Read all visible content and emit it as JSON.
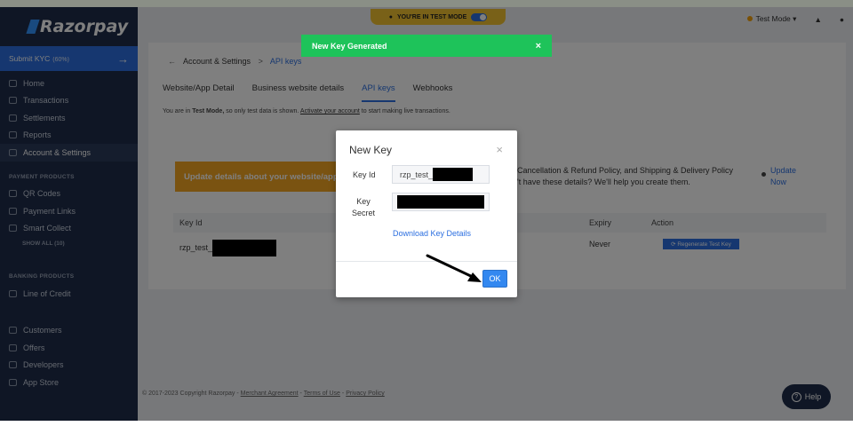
{
  "app": {
    "logo": "Razorpay"
  },
  "sidebar": {
    "kyc_label": "Submit KYC",
    "kyc_progress": "(60%)",
    "kyc_arrow": "→",
    "items": [
      {
        "label": "Home",
        "icon": "home-icon"
      },
      {
        "label": "Transactions",
        "icon": "transactions-icon"
      },
      {
        "label": "Settlements",
        "icon": "settlements-icon"
      },
      {
        "label": "Reports",
        "icon": "reports-icon"
      },
      {
        "label": "Account & Settings",
        "icon": "gear-icon",
        "active": true
      }
    ],
    "payment_heading": "PAYMENT PRODUCTS",
    "payment_items": [
      {
        "label": "QR Codes",
        "icon": "qr-icon"
      },
      {
        "label": "Payment Links",
        "icon": "link-icon"
      },
      {
        "label": "Smart Collect",
        "icon": "bank-icon"
      }
    ],
    "show_all": "SHOW ALL (10)",
    "banking_heading": "BANKING PRODUCTS",
    "banking_items": [
      {
        "label": "Line of Credit",
        "icon": "credit-icon"
      }
    ],
    "bottom_items": [
      {
        "label": "Customers",
        "icon": "customers-icon"
      },
      {
        "label": "Offers",
        "icon": "offers-icon"
      },
      {
        "label": "Developers",
        "icon": "code-icon"
      },
      {
        "label": "App Store",
        "icon": "apps-icon"
      }
    ]
  },
  "header": {
    "mode_pill": "YOU'RE IN TEST MODE",
    "mode_select": "Test Mode",
    "mode_caret": "▾"
  },
  "page": {
    "back": "←",
    "breadcrumb_parent": "Account & Settings",
    "breadcrumb_sep": ">",
    "breadcrumb_current": "API keys",
    "tabs": [
      "Website/App Detail",
      "Business website details",
      "API keys",
      "Webhooks"
    ],
    "notice_prefix": "You are in",
    "notice_mode": "Test Mode,",
    "notice_mid": "so only test data is shown.",
    "notice_link": "Activate your account",
    "notice_suffix": "to start making live transactions.",
    "banner_left": "Update details about your website/app",
    "banner_right": "Cancellation & Refund Policy, and Shipping & Delivery Policy\n't have these details? We'll help you create them.",
    "banner_link": "Update\nNow",
    "table": {
      "headers": [
        "Key Id",
        "Expiry",
        "Action"
      ],
      "row": {
        "key_id": "rzp_test_",
        "expiry": "Never",
        "action": "⟳ Regenerate Test Key"
      }
    },
    "footer": {
      "copyright": "© 2017-2023 Copyright Razorpay",
      "link1": "Merchant Agreement",
      "link2": "Terms of Use",
      "link3": "Privacy Policy",
      "sep": " - "
    },
    "help": "Help",
    "help_glyph": "?"
  },
  "toast": {
    "message": "New Key Generated",
    "close": "×"
  },
  "modal": {
    "title": "New Key",
    "close": "×",
    "key_id_label": "Key Id",
    "key_id_value": "rzp_test_",
    "key_secret_label": "Key\nSecret",
    "download": "Download Key Details",
    "ok": "OK"
  },
  "colors": {
    "sidebar": "#1f2d4a",
    "accent": "#2c6fe0",
    "toast": "#1ec35a",
    "warning": "#f5a623"
  }
}
